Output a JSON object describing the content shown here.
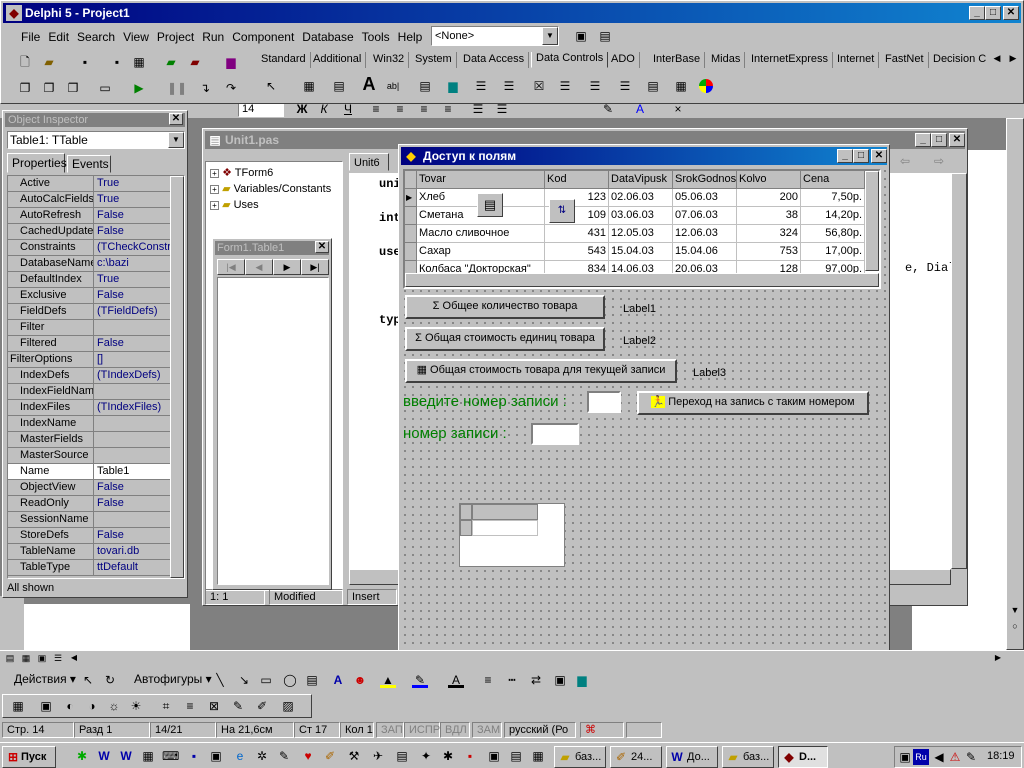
{
  "delphi": {
    "title": "Delphi 5 - Project1",
    "menu": [
      "File",
      "Edit",
      "Search",
      "View",
      "Project",
      "Run",
      "Component",
      "Database",
      "Tools",
      "Help"
    ],
    "combo_value": "<None>",
    "palette_tabs": [
      "Standard",
      "Additional",
      "Win32",
      "System",
      "Data Access",
      "Data Controls",
      "ADO",
      "InterBase",
      "Midas",
      "InternetExpress",
      "Internet",
      "FastNet",
      "Decision C"
    ],
    "active_tab": "Data Controls"
  },
  "word_toolbar": {
    "size_value": "14"
  },
  "object_inspector": {
    "title": "Object Inspector",
    "selector": "Table1: TTable",
    "tabs": [
      "Properties",
      "Events"
    ],
    "props": [
      {
        "k": "Active",
        "v": "True"
      },
      {
        "k": "AutoCalcFields",
        "v": "True"
      },
      {
        "k": "AutoRefresh",
        "v": "False"
      },
      {
        "k": "CachedUpdate",
        "v": "False"
      },
      {
        "k": "Constraints",
        "v": "(TCheckConstra"
      },
      {
        "k": "DatabaseName",
        "v": "c:\\bazi"
      },
      {
        "k": "DefaultIndex",
        "v": "True"
      },
      {
        "k": "Exclusive",
        "v": "False"
      },
      {
        "k": "FieldDefs",
        "v": "(TFieldDefs)"
      },
      {
        "k": "Filter",
        "v": ""
      },
      {
        "k": "Filtered",
        "v": "False"
      },
      {
        "k": "FilterOptions",
        "v": "[]"
      },
      {
        "k": "IndexDefs",
        "v": "(TIndexDefs)"
      },
      {
        "k": "IndexFieldName",
        "v": ""
      },
      {
        "k": "IndexFiles",
        "v": "(TIndexFiles)"
      },
      {
        "k": "IndexName",
        "v": ""
      },
      {
        "k": "MasterFields",
        "v": ""
      },
      {
        "k": "MasterSource",
        "v": ""
      },
      {
        "k": "Name",
        "v": "Table1"
      },
      {
        "k": "ObjectView",
        "v": "False"
      },
      {
        "k": "ReadOnly",
        "v": "False"
      },
      {
        "k": "SessionName",
        "v": ""
      },
      {
        "k": "StoreDefs",
        "v": "False"
      },
      {
        "k": "TableName",
        "v": "tovari.db"
      },
      {
        "k": "TableType",
        "v": "ttDefault"
      }
    ],
    "status": "All shown"
  },
  "editor": {
    "title": "Unit1.pas",
    "tree": [
      "TForm6",
      "Variables/Constants",
      "Uses"
    ],
    "tab": "Unit6",
    "code_frag": [
      "uni",
      "int",
      "use",
      "typ"
    ],
    "code_right": "e, Dialo",
    "status_pos": "1:  1",
    "status_mod": "Modified",
    "status_ins": "Insert"
  },
  "table_window": {
    "title": "Form1.Table1"
  },
  "form": {
    "title": "Доступ к полям",
    "columns": [
      "Tovar",
      "Kod",
      "DataVipusk",
      "SrokGodnos",
      "Kolvo",
      "Cena"
    ],
    "rows": [
      [
        "Хлеб",
        "123",
        "02.06.03",
        "05.06.03",
        "200",
        "7,50р."
      ],
      [
        "Сметана",
        "109",
        "03.06.03",
        "07.06.03",
        "38",
        "14,20р."
      ],
      [
        "Масло сливочное",
        "431",
        "12.05.03",
        "12.06.03",
        "324",
        "56,80р."
      ],
      [
        "Сахар",
        "543",
        "15.04.03",
        "15.04.06",
        "753",
        "17,00р."
      ],
      [
        "Колбаса \"Докторская\"",
        "834",
        "14.06.03",
        "20.06.03",
        "128",
        "97,00р."
      ]
    ],
    "btn1": "Общее количество товара",
    "label1": "Label1",
    "btn2": "Общая стоимость единиц товара",
    "label2": "Label2",
    "btn3": "Общая стоимость товара для текущей записи",
    "label3": "Label3",
    "prompt1": "введите номер записи :",
    "goto_btn": "Переход на запись с таким номером",
    "prompt2": "номер записи :"
  },
  "word_draw": {
    "actions": "Действия",
    "autoshapes": "Автофигуры"
  },
  "word_status": [
    "Стр. 14",
    "Разд 1",
    "14/21",
    "На 21,6см",
    "Ст 17",
    "Кол 1",
    "ЗАП",
    "ИСПР",
    "ВДЛ",
    "ЗАМ",
    "русский (Ро"
  ],
  "taskbar": {
    "start": "Пуск",
    "buttons": [
      "баз...",
      "24...",
      "До...",
      "баз...",
      "D..."
    ],
    "clock": "18:19",
    "lang": "Ru"
  }
}
